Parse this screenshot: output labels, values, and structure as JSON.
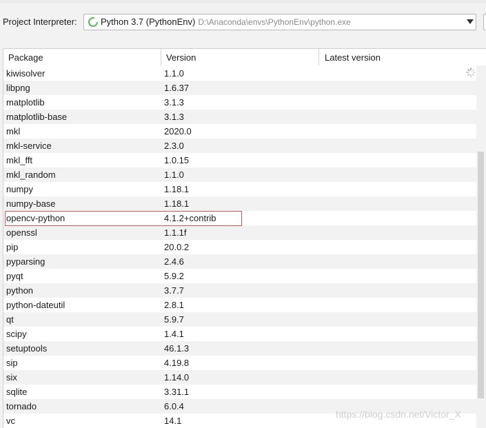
{
  "interpreter": {
    "label": "Project Interpreter:",
    "selected_name": "Python 3.7 (PythonEnv)",
    "selected_path": "D:\\Anaconda\\envs\\PythonEnv\\python.exe"
  },
  "table": {
    "columns": [
      "Package",
      "Version",
      "Latest version"
    ],
    "rows": [
      {
        "package": "kiwisolver",
        "version": "1.1.0"
      },
      {
        "package": "libpng",
        "version": "1.6.37"
      },
      {
        "package": "matplotlib",
        "version": "3.1.3"
      },
      {
        "package": "matplotlib-base",
        "version": "3.1.3"
      },
      {
        "package": "mkl",
        "version": "2020.0"
      },
      {
        "package": "mkl-service",
        "version": "2.3.0"
      },
      {
        "package": "mkl_fft",
        "version": "1.0.15"
      },
      {
        "package": "mkl_random",
        "version": "1.1.0"
      },
      {
        "package": "numpy",
        "version": "1.18.1"
      },
      {
        "package": "numpy-base",
        "version": "1.18.1"
      },
      {
        "package": "opencv-python",
        "version": "4.1.2+contrib"
      },
      {
        "package": "openssl",
        "version": "1.1.1f"
      },
      {
        "package": "pip",
        "version": "20.0.2"
      },
      {
        "package": "pyparsing",
        "version": "2.4.6"
      },
      {
        "package": "pyqt",
        "version": "5.9.2"
      },
      {
        "package": "python",
        "version": "3.7.7"
      },
      {
        "package": "python-dateutil",
        "version": "2.8.1"
      },
      {
        "package": "qt",
        "version": "5.9.7"
      },
      {
        "package": "scipy",
        "version": "1.4.1"
      },
      {
        "package": "setuptools",
        "version": "46.1.3"
      },
      {
        "package": "sip",
        "version": "4.19.8"
      },
      {
        "package": "six",
        "version": "1.14.0"
      },
      {
        "package": "sqlite",
        "version": "3.31.1"
      },
      {
        "package": "tornado",
        "version": "6.0.4"
      },
      {
        "package": "vc",
        "version": "14.1"
      }
    ],
    "highlighted_package": "opencv-python"
  },
  "watermark": "https://blog.csdn.net/Victor_X",
  "colors": {
    "highlight_border": "#d9534f",
    "alt_row": "#f2f2f2",
    "python_icon": "#5cb85c"
  },
  "icons": {
    "interpreter": "python-loading-icon",
    "dropdown": "chevron-down-icon",
    "spinner": "loading-spinner-icon"
  }
}
